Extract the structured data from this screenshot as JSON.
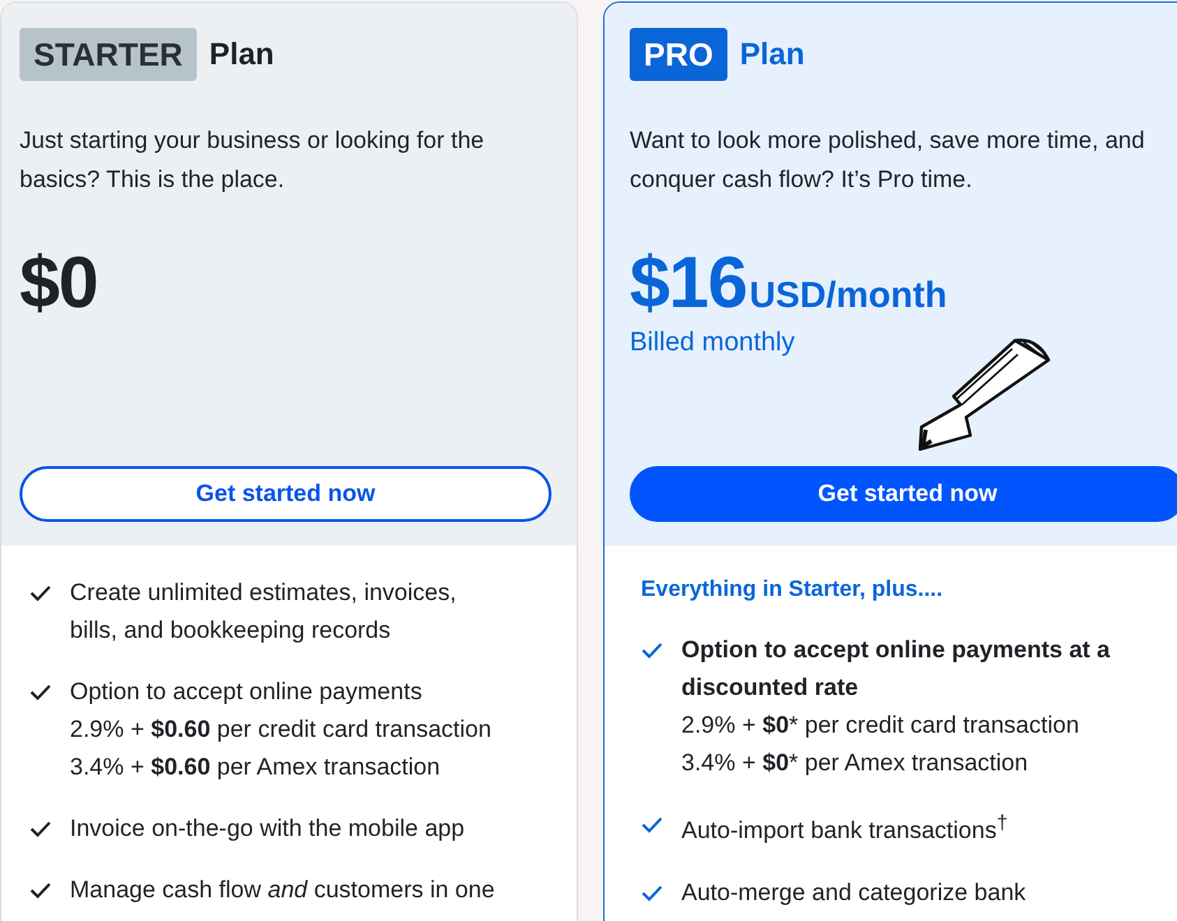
{
  "plans": [
    {
      "badge": "STARTER",
      "plan_label": "Plan",
      "highlighted": false,
      "description": "Just starting your business or looking for the basics? This is the place.",
      "price": "$0",
      "cta": "Get started now",
      "features": [
        {
          "lines": [
            "Create unlimited estimates, invoices,",
            "bills, and bookkeeping records"
          ]
        },
        {
          "lines": [
            "Option to accept online payments",
            "2.9% + **$0.60** per credit card transaction",
            "3.4% + **$0.60** per Amex transaction"
          ]
        },
        {
          "lines": [
            "Invoice on-the-go with the mobile app"
          ]
        },
        {
          "lines": [
            "Manage cash flow *and* customers in one"
          ]
        }
      ]
    },
    {
      "badge": "PRO",
      "plan_label": "Plan",
      "highlighted": true,
      "description": "Want to look more polished, save more time, and conquer cash flow? It’s Pro time.",
      "price": "$16",
      "price_unit": "USD/month",
      "billing": "Billed monthly",
      "cta": "Get started now",
      "features_heading": "Everything in Starter, plus....",
      "features": [
        {
          "lines": [
            "**Option to accept online payments at a**",
            "**discounted rate**",
            "2.9% + **$0*** per credit card transaction",
            "3.4% + **$0*** per Amex transaction"
          ]
        },
        {
          "lines": [
            "Auto-import bank transactions$^{†}$"
          ]
        },
        {
          "lines": [
            "Auto-merge and categorize bank"
          ]
        }
      ]
    }
  ]
}
